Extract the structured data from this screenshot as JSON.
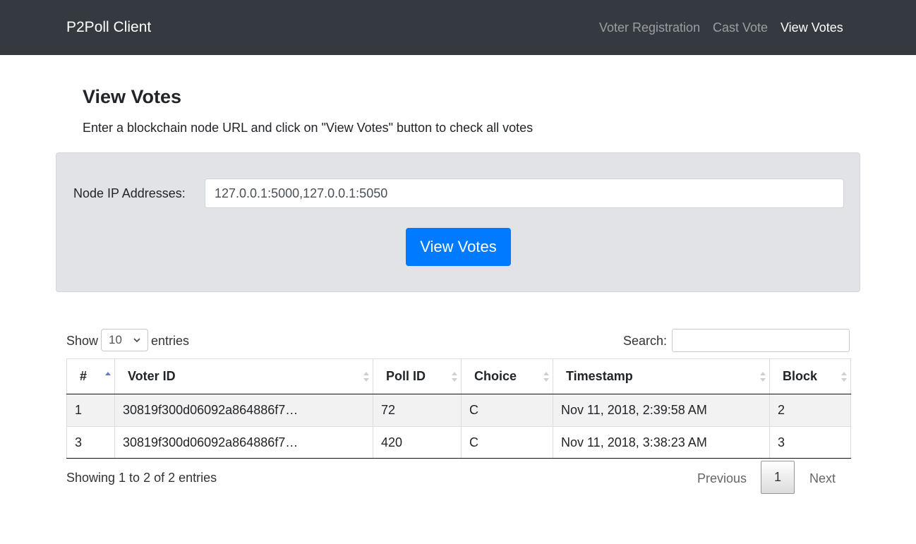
{
  "navbar": {
    "brand": "P2Poll Client",
    "links": [
      "Voter Registration",
      "Cast Vote",
      "View Votes"
    ],
    "active_link": "View Votes"
  },
  "page": {
    "title": "View Votes",
    "intro": "Enter a blockchain node URL and click on \"View Votes\" button to check all votes"
  },
  "form": {
    "node_label": "Node IP Addresses:",
    "node_value": "127.0.0.1:5000,127.0.0.1:5050",
    "submit_label": "View Votes"
  },
  "table_controls": {
    "show_label": "Show",
    "page_length": "10",
    "entries_label": "entries",
    "search_label": "Search:"
  },
  "table": {
    "columns": [
      "#",
      "Voter ID",
      "Poll ID",
      "Choice",
      "Timestamp",
      "Block"
    ],
    "sorted_column": "#",
    "sort_direction": "ascending",
    "rows": [
      [
        "1",
        "30819f300d06092a864886f7…",
        "72",
        "C",
        "Nov 11, 2018, 2:39:58 AM",
        "2"
      ],
      [
        "3",
        "30819f300d06092a864886f7…",
        "420",
        "C",
        "Nov 11, 2018, 3:38:23 AM",
        "3"
      ]
    ]
  },
  "pagination": {
    "info": "Showing 1 to 2 of 2 entries",
    "previous": "Previous",
    "current_page": "1",
    "next": "Next"
  },
  "colors": {
    "navbar_bg": "#343a40",
    "primary": "#007bff",
    "panel_bg": "#e1e3e6",
    "sort_active": "#6f77c8"
  }
}
